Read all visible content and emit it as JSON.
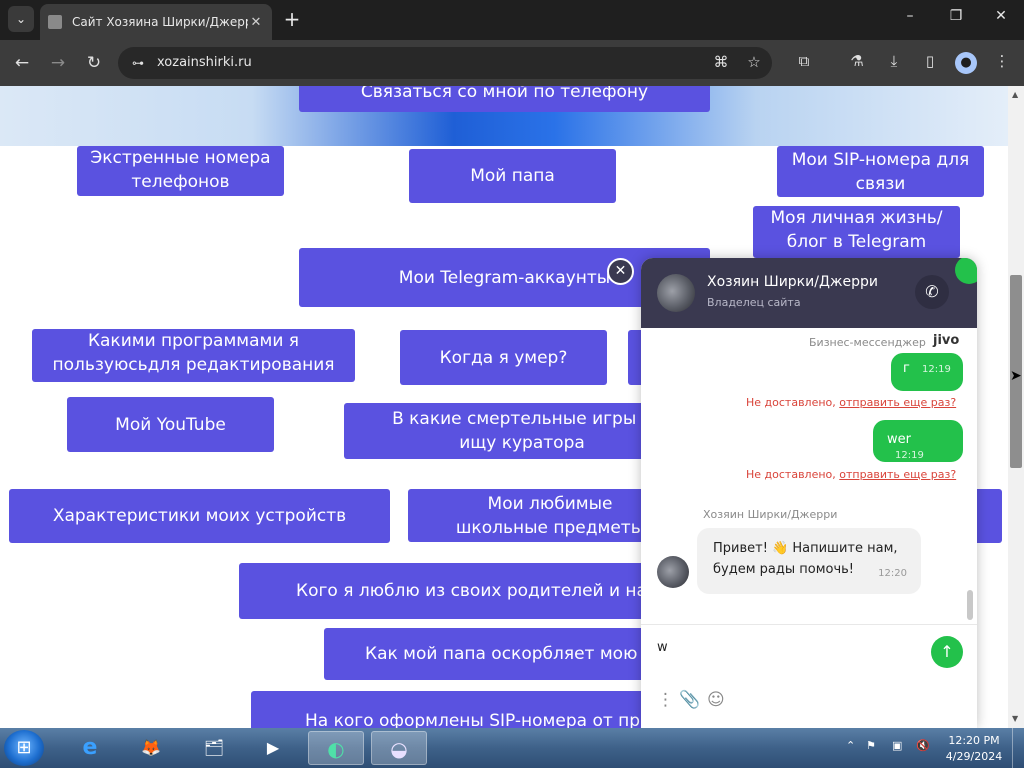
{
  "browser": {
    "tab_title": "Сайт Хозяина Ширки/Джерри",
    "tab_dropdown_icon": "chevron-down-icon",
    "url": "xozainshirki.ru",
    "window_controls": {
      "minimize": "–",
      "maximize": "❐",
      "close": "✕"
    },
    "icons": {
      "back": "←",
      "forward": "→",
      "reload": "↻",
      "new_tab": "+",
      "site_info": "⊶",
      "translate": "⌘",
      "bookmark": "☆",
      "extensions": "⧉",
      "labs": "⚗",
      "downloads": "⤓",
      "side_panel": "▯",
      "profile": "●",
      "menu": "⋮"
    }
  },
  "page": {
    "hero_button": "Связаться со мной по телефону",
    "buttons": [
      {
        "id": "emergency",
        "label": "Экстренные номера телефонов"
      },
      {
        "id": "dad",
        "label": "Мой папа"
      },
      {
        "id": "sip",
        "label": "Мои SIP-номера для связи"
      },
      {
        "id": "blog",
        "label": "Моя личная жизнь/блог в Telegram"
      },
      {
        "id": "telegram",
        "label": "Мои Telegram-аккаунты"
      },
      {
        "id": "programs",
        "label": "Какими программами я пользуюсьдля редактирования документов"
      },
      {
        "id": "died",
        "label": "Когда я умер?"
      },
      {
        "id": "hidden1",
        "label": ""
      },
      {
        "id": "youtube",
        "label": "Мой YouTube"
      },
      {
        "id": "games",
        "label": "В какие смертельные игры я ищу куратора"
      },
      {
        "id": "devices",
        "label": "Характеристики моих устройств"
      },
      {
        "id": "subjects",
        "label": "Мои любимые школьные предметы"
      },
      {
        "id": "hidden2",
        "label": ""
      },
      {
        "id": "parents",
        "label": "Кого я люблю из своих родителей и наско"
      },
      {
        "id": "insults",
        "label": "Как мой папа оскорбляет мою ма"
      },
      {
        "id": "sip_owners",
        "label": "На кого оформлены SIP-номера от пров"
      }
    ]
  },
  "chat": {
    "operator_name": "Хозяин Ширки/Джерри",
    "operator_role": "Владелец сайта",
    "business_label": "Бизнес-мессенджер",
    "brand": "jivo",
    "close_icon": "✕",
    "call_icon": "✆",
    "outgoing": [
      {
        "text": "г",
        "time": "12:19",
        "status": "Не доставлено,",
        "retry": "отправить еще раз?"
      },
      {
        "text": "wer",
        "time": "12:19",
        "status": "Не доставлено,",
        "retry": "отправить еще раз?"
      }
    ],
    "incoming": {
      "sender": "Хозяин Ширки/Джерри",
      "text": "Привет! 👋 Напишите нам, будем рады помочь!",
      "time": "12:20"
    },
    "input_value": "w",
    "send_icon": "↑",
    "more_icon": "⋮",
    "attach_icon": "📎",
    "emoji_icon": "☺",
    "accent_color": "#23c14b",
    "header_color": "#3a3950"
  },
  "taskbar": {
    "start_icon": "⊞",
    "apps": [
      {
        "name": "ie-icon",
        "glyph": "e"
      },
      {
        "name": "firefox-icon",
        "glyph": "🦊"
      },
      {
        "name": "explorer-icon",
        "glyph": "🗂"
      },
      {
        "name": "media-player-icon",
        "glyph": "▶"
      },
      {
        "name": "app-icon",
        "glyph": "◐"
      },
      {
        "name": "app2-icon",
        "glyph": "◒"
      }
    ],
    "tray_icons": [
      "⌃",
      "⚑",
      "▣",
      "🔇"
    ],
    "time": "12:20 PM",
    "date": "4/29/2024"
  },
  "colors": {
    "button": "#5a52e0",
    "tab_bar": "#1f1f1f",
    "toolbar": "#3c3c3c"
  }
}
